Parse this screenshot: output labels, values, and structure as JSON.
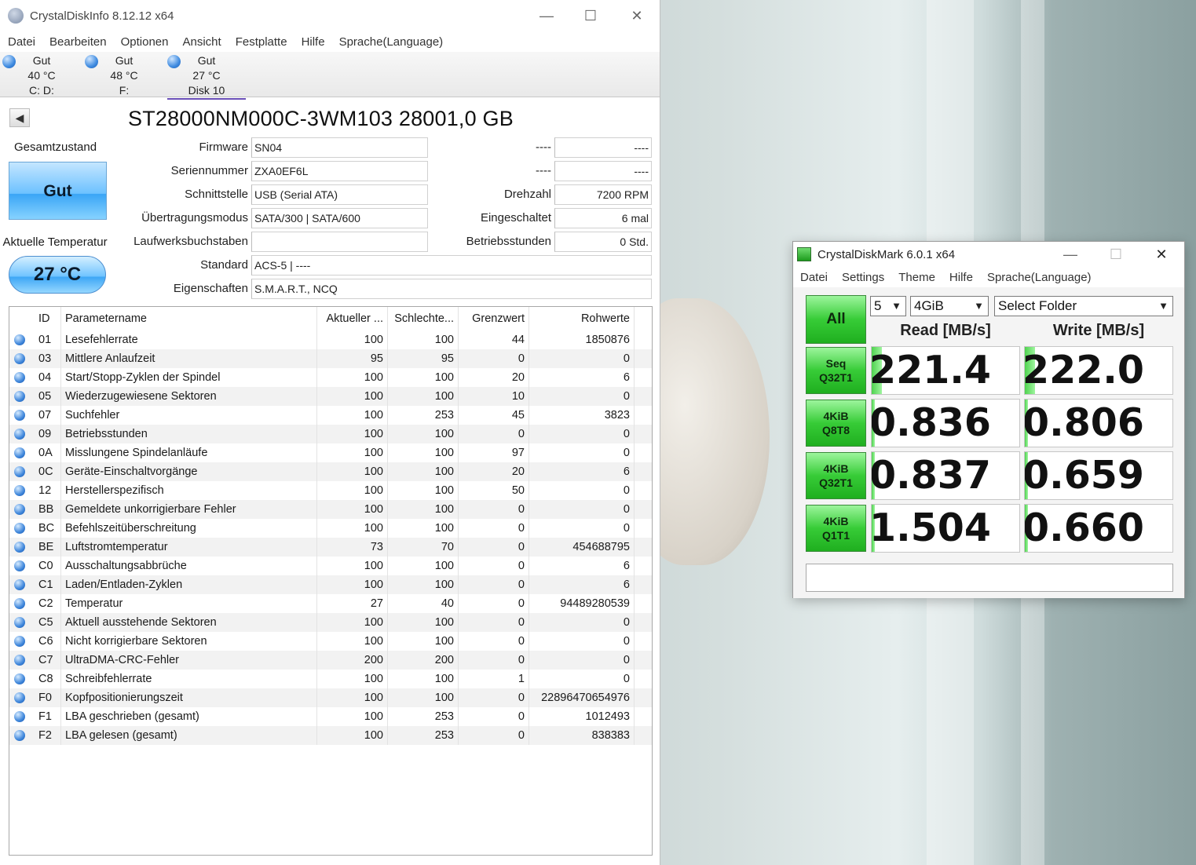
{
  "crystaldiskinfo": {
    "title": "CrystalDiskInfo 8.12.12 x64",
    "menu": [
      "Datei",
      "Bearbeiten",
      "Optionen",
      "Ansicht",
      "Festplatte",
      "Hilfe",
      "Sprache(Language)"
    ],
    "disks": [
      {
        "status": "Gut",
        "temp": "40 °C",
        "label": "C: D:"
      },
      {
        "status": "Gut",
        "temp": "48 °C",
        "label": "F:"
      },
      {
        "status": "Gut",
        "temp": "27 °C",
        "label": "Disk 10"
      }
    ],
    "model": "ST28000NM000C-3WM103 28001,0 GB",
    "health_label": "Gesamtzustand",
    "health_value": "Gut",
    "temp_label": "Aktuelle Temperatur",
    "temp_value": "27 °C",
    "fields": {
      "firmware_label": "Firmware",
      "firmware": "SN04",
      "serial_label": "Seriennummer",
      "serial": "ZXA0EF6L",
      "interface_label": "Schnittstelle",
      "interface": "USB (Serial ATA)",
      "transfer_label": "Übertragungsmodus",
      "transfer": "SATA/300 | SATA/600",
      "drive_letter_label": "Laufwerksbuchstaben",
      "drive_letter": "",
      "standard_label": "Standard",
      "standard": "ACS-5 | ----",
      "features_label": "Eigenschaften",
      "features": "S.M.A.R.T., NCQ",
      "r1_label": "----",
      "r1": "----",
      "r2_label": "----",
      "r2": "----",
      "rpm_label": "Drehzahl",
      "rpm": "7200 RPM",
      "power_on_count_label": "Eingeschaltet",
      "power_on_count": "6 mal",
      "power_on_hours_label": "Betriebsstunden",
      "power_on_hours": "0 Std."
    },
    "smart_headers": [
      "",
      "ID",
      "Parametername",
      "Aktueller ...",
      "Schlechte...",
      "Grenzwert",
      "Rohwerte"
    ],
    "smart_rows": [
      [
        "01",
        "Lesefehlerrate",
        "100",
        "100",
        "44",
        "1850876"
      ],
      [
        "03",
        "Mittlere Anlaufzeit",
        "95",
        "95",
        "0",
        "0"
      ],
      [
        "04",
        "Start/Stopp-Zyklen der Spindel",
        "100",
        "100",
        "20",
        "6"
      ],
      [
        "05",
        "Wiederzugewiesene Sektoren",
        "100",
        "100",
        "10",
        "0"
      ],
      [
        "07",
        "Suchfehler",
        "100",
        "253",
        "45",
        "3823"
      ],
      [
        "09",
        "Betriebsstunden",
        "100",
        "100",
        "0",
        "0"
      ],
      [
        "0A",
        "Misslungene Spindelanläufe",
        "100",
        "100",
        "97",
        "0"
      ],
      [
        "0C",
        "Geräte-Einschaltvorgänge",
        "100",
        "100",
        "20",
        "6"
      ],
      [
        "12",
        "Herstellerspezifisch",
        "100",
        "100",
        "50",
        "0"
      ],
      [
        "BB",
        "Gemeldete unkorrigierbare Fehler",
        "100",
        "100",
        "0",
        "0"
      ],
      [
        "BC",
        "Befehlszeitüberschreitung",
        "100",
        "100",
        "0",
        "0"
      ],
      [
        "BE",
        "Luftstromtemperatur",
        "73",
        "70",
        "0",
        "454688795"
      ],
      [
        "C0",
        "Ausschaltungsabbrüche",
        "100",
        "100",
        "0",
        "6"
      ],
      [
        "C1",
        "Laden/Entladen-Zyklen",
        "100",
        "100",
        "0",
        "6"
      ],
      [
        "C2",
        "Temperatur",
        "27",
        "40",
        "0",
        "94489280539"
      ],
      [
        "C5",
        "Aktuell ausstehende Sektoren",
        "100",
        "100",
        "0",
        "0"
      ],
      [
        "C6",
        "Nicht korrigierbare Sektoren",
        "100",
        "100",
        "0",
        "0"
      ],
      [
        "C7",
        "UltraDMA-CRC-Fehler",
        "200",
        "200",
        "0",
        "0"
      ],
      [
        "C8",
        "Schreibfehlerrate",
        "100",
        "100",
        "1",
        "0"
      ],
      [
        "F0",
        "Kopfpositionierungszeit",
        "100",
        "100",
        "0",
        "22896470654976"
      ],
      [
        "F1",
        "LBA geschrieben (gesamt)",
        "100",
        "253",
        "0",
        "1012493"
      ],
      [
        "F2",
        "LBA gelesen (gesamt)",
        "100",
        "253",
        "0",
        "838383"
      ]
    ]
  },
  "crystaldiskmark": {
    "title": "CrystalDiskMark 6.0.1 x64",
    "menu": [
      "Datei",
      "Settings",
      "Theme",
      "Hilfe",
      "Sprache(Language)"
    ],
    "all_label": "All",
    "count": "5",
    "size": "4GiB",
    "folder": "Select Folder",
    "read_header": "Read [MB/s]",
    "write_header": "Write [MB/s]",
    "tests": [
      {
        "line1": "Seq",
        "line2": "Q32T1",
        "read": "221.4",
        "write": "222.0",
        "read_fill": 0.07,
        "write_fill": 0.07
      },
      {
        "line1": "4KiB",
        "line2": "Q8T8",
        "read": "0.836",
        "write": "0.806",
        "read_fill": 0.02,
        "write_fill": 0.02
      },
      {
        "line1": "4KiB",
        "line2": "Q32T1",
        "read": "0.837",
        "write": "0.659",
        "read_fill": 0.02,
        "write_fill": 0.02
      },
      {
        "line1": "4KiB",
        "line2": "Q1T1",
        "read": "1.504",
        "write": "0.660",
        "read_fill": 0.02,
        "write_fill": 0.02
      }
    ],
    "comment": ""
  }
}
